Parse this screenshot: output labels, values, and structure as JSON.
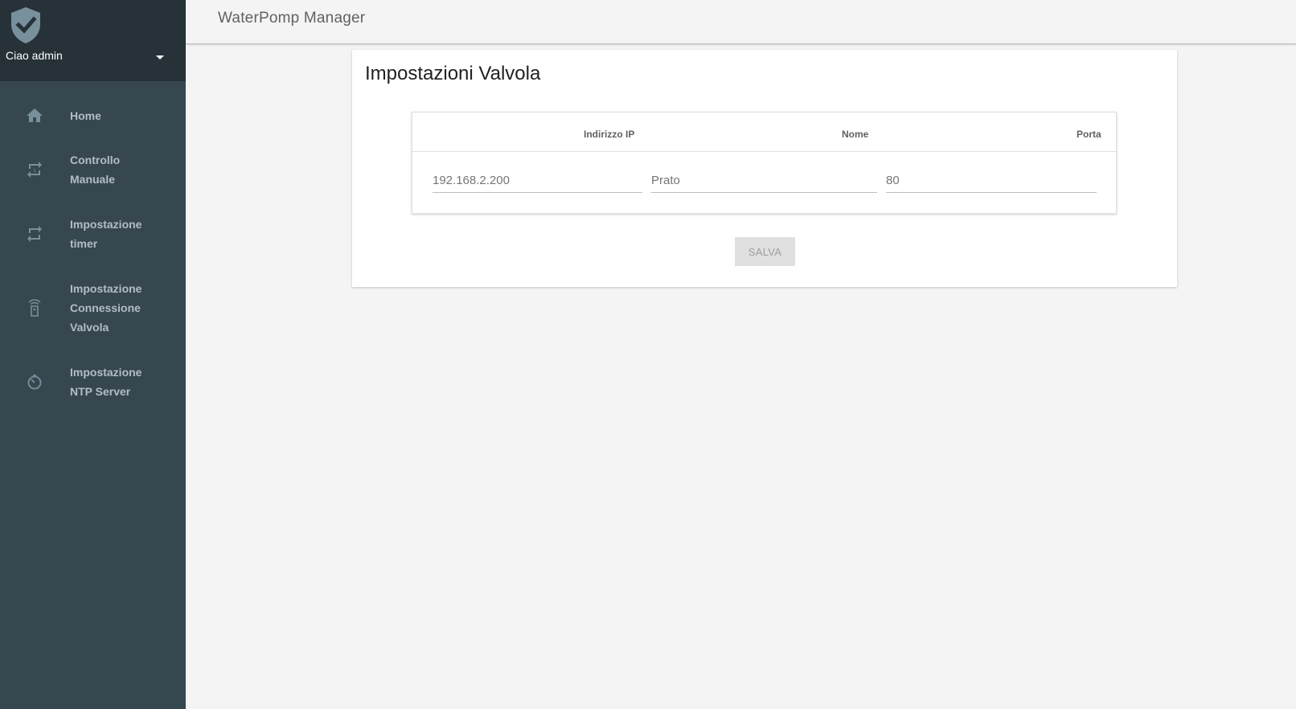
{
  "sidebar": {
    "greeting": "Ciao admin",
    "items": [
      {
        "label": "Home",
        "icon": "home-icon"
      },
      {
        "label": "Controllo\nManuale",
        "icon": "repeat-icon"
      },
      {
        "label": "Impostazione\ntimer",
        "icon": "repeat-icon"
      },
      {
        "label": "Impostazione\nConnessione\nValvola",
        "icon": "remote-icon"
      },
      {
        "label": "Impostazione\nNTP Server",
        "icon": "timer-icon"
      }
    ]
  },
  "header": {
    "title": "WaterPomp Manager"
  },
  "main": {
    "card_title": "Impostazioni Valvola",
    "table": {
      "columns": [
        "Indirizzo IP",
        "Nome",
        "Porta"
      ],
      "row": {
        "ip": "192.168.2.200",
        "name": "Prato",
        "port": "80"
      }
    },
    "save_label": "SALVA"
  },
  "colors": {
    "sidebar_bg": "#37474f",
    "sidebar_header_bg": "#263238",
    "page_bg": "#f4f4f4",
    "card_bg": "#ffffff",
    "button_disabled_bg": "#e0e0e0"
  }
}
